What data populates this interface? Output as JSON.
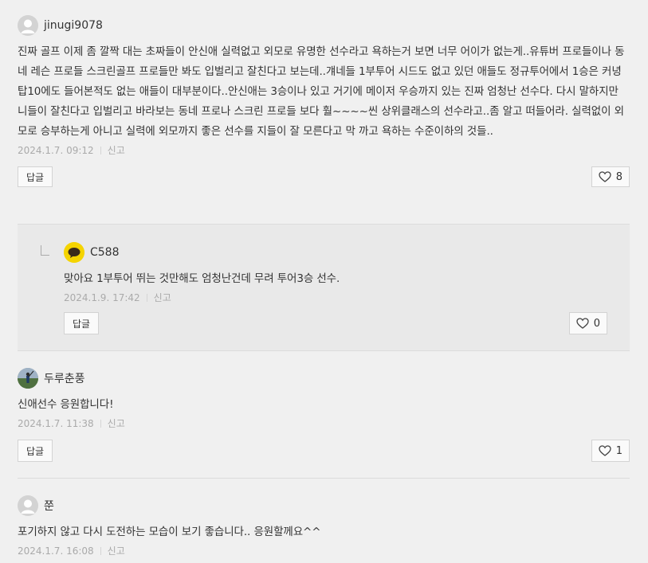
{
  "comments": [
    {
      "nickname": "jinugi9078",
      "text": "진짜 골프 이제 좀 깔짝 대는 초짜들이 안신애 실력없고 외모로 유명한 선수라고 욕하는거 보면 너무 어이가 없는게..유튜버 프로들이나 동네 레슨 프로들 스크린골프 프로들만 봐도 입벌리고 잘친다고 보는데..걔네들 1부투어 시드도 없고 있던 애들도 정규투어에서 1승은 커녕 탑10에도 들어본적도 없는 애들이 대부분이다..안신애는 3승이나 있고 거기에 메이저 우승까지 있는 진짜 엄청난 선수다. 다시 말하지만 니들이 잘친다고 입벌리고 바라보는 동네 프로나 스크린 프로들 보다 훨~~~~씬 상위클래스의 선수라고..좀 알고 떠들어라. 실력없이 외모로 승부하는게 아니고 실력에 외모까지 좋은 선수를 지들이 잘 모른다고 막 까고 욕하는 수준이하의 것들..",
      "date": "2024.1.7. 09:12",
      "report": "신고",
      "reply_label": "답글",
      "likes": "8"
    },
    {
      "nickname": "두루춘풍",
      "text": "신애선수 응원합니다!",
      "date": "2024.1.7. 11:38",
      "report": "신고",
      "reply_label": "답글",
      "likes": "1"
    },
    {
      "nickname": "쭌",
      "text": "포기하지 않고 다시 도전하는 모습이 보기 좋습니다.. 응원할께요^^",
      "date": "2024.1.7. 16:08",
      "report": "신고"
    }
  ],
  "reply": {
    "nickname": "C588",
    "text": "맞아요 1부투어 뛰는 것만해도 엄청난건데 무려 투어3승 선수.",
    "date": "2024.1.9. 17:42",
    "report": "신고",
    "reply_label": "답글",
    "likes": "0"
  },
  "icons": {
    "avatar_default": "default-avatar-icon",
    "avatar_kakao": "kakao-talk-icon",
    "like": "heart-icon"
  }
}
